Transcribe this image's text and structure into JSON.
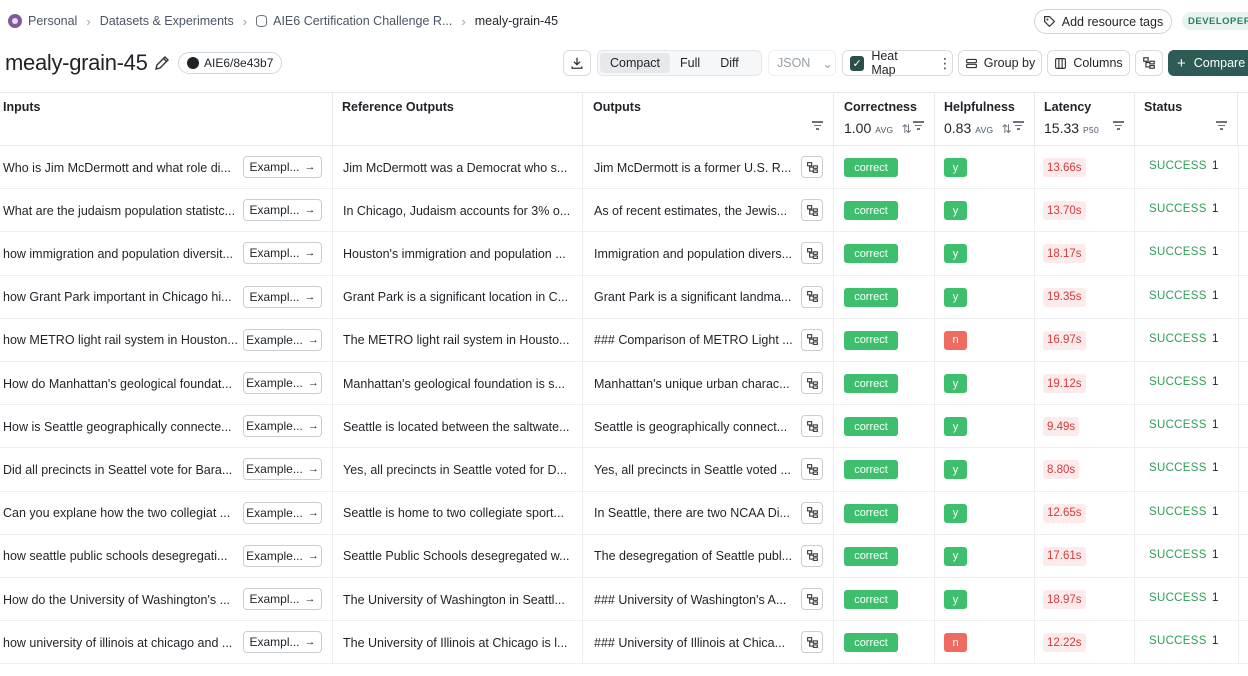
{
  "breadcrumb": {
    "workspace": "Personal",
    "section": "Datasets & Experiments",
    "dataset": "AIE6 Certification Challenge R...",
    "experiment": "mealy-grain-45"
  },
  "header": {
    "add_tags_label": "Add resource tags",
    "env_badge": "DEVELOPER"
  },
  "title": {
    "name": "mealy-grain-45",
    "commit": "AIE6/8e43b7"
  },
  "toolbar": {
    "views": [
      "Compact",
      "Full",
      "Diff"
    ],
    "active_view": "Compact",
    "format": "JSON",
    "heatmap_label": "Heat Map",
    "group_by_label": "Group by",
    "columns_label": "Columns",
    "compare_label": "Compare"
  },
  "columns": {
    "inputs": "Inputs",
    "reference": "Reference Outputs",
    "outputs": "Outputs",
    "correctness": {
      "label": "Correctness",
      "value": "1.00",
      "stat": "AVG"
    },
    "helpfulness": {
      "label": "Helpfulness",
      "value": "0.83",
      "stat": "AVG"
    },
    "latency": {
      "label": "Latency",
      "value": "15.33",
      "stat": "P50"
    },
    "status": "Status"
  },
  "rows": [
    {
      "input": "Who is Jim McDermott and what role di...",
      "example": "Exampl...",
      "reference": "Jim McDermott was a Democrat who s...",
      "output": "Jim McDermott is a former U.S. R...",
      "correctness": "correct",
      "helpfulness": "y",
      "latency": "13.66s",
      "status": "SUCCESS",
      "count": "1"
    },
    {
      "input": "What are the judaism population statistc...",
      "example": "Exampl...",
      "reference": "In Chicago, Judaism accounts for 3% o...",
      "output": "As of recent estimates, the Jewis...",
      "correctness": "correct",
      "helpfulness": "y",
      "latency": "13.70s",
      "status": "SUCCESS",
      "count": "1"
    },
    {
      "input": "how immigration and population diversit...",
      "example": "Exampl...",
      "reference": "Houston's immigration and population ...",
      "output": "Immigration and population divers...",
      "correctness": "correct",
      "helpfulness": "y",
      "latency": "18.17s",
      "status": "SUCCESS",
      "count": "1"
    },
    {
      "input": "how Grant Park important in Chicago hi...",
      "example": "Exampl...",
      "reference": "Grant Park is a significant location in C...",
      "output": "Grant Park is a significant landma...",
      "correctness": "correct",
      "helpfulness": "y",
      "latency": "19.35s",
      "status": "SUCCESS",
      "count": "1"
    },
    {
      "input": "how METRO light rail system in Houston...",
      "example": "Example...",
      "reference": "The METRO light rail system in Housto...",
      "output": "### Comparison of METRO Light ...",
      "correctness": "correct",
      "helpfulness": "n",
      "latency": "16.97s",
      "status": "SUCCESS",
      "count": "1"
    },
    {
      "input": "How do Manhattan's geological foundat...",
      "example": "Example...",
      "reference": "Manhattan's geological foundation is s...",
      "output": "Manhattan's unique urban charac...",
      "correctness": "correct",
      "helpfulness": "y",
      "latency": "19.12s",
      "status": "SUCCESS",
      "count": "1"
    },
    {
      "input": "How is Seattle geographically connecte...",
      "example": "Example...",
      "reference": "Seattle is located between the saltwate...",
      "output": "Seattle is geographically connect...",
      "correctness": "correct",
      "helpfulness": "y",
      "latency": "9.49s",
      "status": "SUCCESS",
      "count": "1"
    },
    {
      "input": "Did all precincts in Seattel vote for Bara...",
      "example": "Example...",
      "reference": "Yes, all precincts in Seattle voted for D...",
      "output": "Yes, all precincts in Seattle voted ...",
      "correctness": "correct",
      "helpfulness": "y",
      "latency": "8.80s",
      "status": "SUCCESS",
      "count": "1"
    },
    {
      "input": "Can you explane how the two collegiat ...",
      "example": "Example...",
      "reference": "Seattle is home to two collegiate sport...",
      "output": "In Seattle, there are two NCAA Di...",
      "correctness": "correct",
      "helpfulness": "y",
      "latency": "12.65s",
      "status": "SUCCESS",
      "count": "1"
    },
    {
      "input": "how seattle public schools desegregati...",
      "example": "Example...",
      "reference": "Seattle Public Schools desegregated w...",
      "output": "The desegregation of Seattle publ...",
      "correctness": "correct",
      "helpfulness": "y",
      "latency": "17.61s",
      "status": "SUCCESS",
      "count": "1"
    },
    {
      "input": "How do the University of Washington's ...",
      "example": "Exampl...",
      "reference": "The University of Washington in Seattl...",
      "output": "### University of Washington's A...",
      "correctness": "correct",
      "helpfulness": "y",
      "latency": "18.97s",
      "status": "SUCCESS",
      "count": "1"
    },
    {
      "input": "how university of illinois at chicago and ...",
      "example": "Exampl...",
      "reference": "The University of Illinois at Chicago is l...",
      "output": "### University of Illinois at Chica...",
      "correctness": "correct",
      "helpfulness": "n",
      "latency": "12.22s",
      "status": "SUCCESS",
      "count": "1"
    }
  ]
}
